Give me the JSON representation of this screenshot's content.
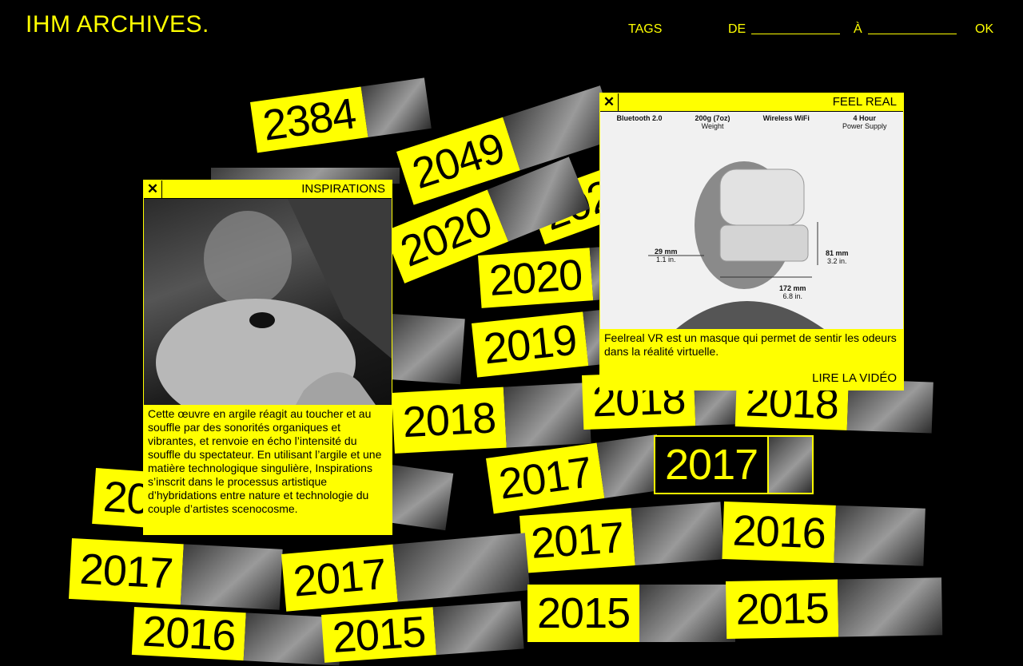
{
  "header": {
    "logo": "IHM ARCHIVES.",
    "tags_label": "TAGS",
    "from_label": "DE",
    "to_label": "À",
    "ok_label": "OK",
    "from_value": "",
    "to_value": ""
  },
  "tiles": {
    "t2384": "2384",
    "t2049": "2049",
    "t2020a": "2020",
    "t2020b": "2020",
    "t2020c": "2020",
    "t2019": "2019",
    "t2018a": "2018",
    "t2018b": "2018",
    "t2018c": "2018",
    "t2017a": "2017",
    "t2017b": "2017",
    "t2017c": "2017",
    "t2017d": "2017",
    "t2017e": "2017",
    "t2016a": "2016",
    "t2016b": "2016",
    "t2016c": "2016",
    "t2015a": "2015",
    "t2015b": "2015",
    "t2015c": "2015"
  },
  "inspirations": {
    "close": "✕",
    "title": "INSPIRATIONS",
    "description": "Cette œuvre en argile réagit au toucher et au souffle par des sonorités organiques et vibrantes, et renvoie en écho l’intensité du souffle du spectateur. En utilisant l’argile et une matière technologique singulière, Inspirations s’inscrit dans le processus artistique d’hybridations entre nature et technologie du couple d’artistes scenocosme."
  },
  "feelreal": {
    "close": "✕",
    "title": "FEEL REAL",
    "specs": [
      {
        "value": "Bluetooth 2.0",
        "label": ""
      },
      {
        "value": "200g (7oz)",
        "label": "Weight"
      },
      {
        "value": "Wireless WiFi",
        "label": ""
      },
      {
        "value": "4 Hour",
        "label": "Power Supply"
      }
    ],
    "dims": {
      "width": "29 mm",
      "width_in": "1.1 in.",
      "height": "81 mm",
      "height_in": "3.2 in.",
      "depth": "172 mm",
      "depth_in": "6.8 in."
    },
    "description": "Feelreal VR est un masque qui permet de sentir les odeurs dans la réalité virtuelle.",
    "read_more": "LIRE LA VIDÉO"
  },
  "colors": {
    "accent": "#ffff00",
    "background": "#000000"
  }
}
